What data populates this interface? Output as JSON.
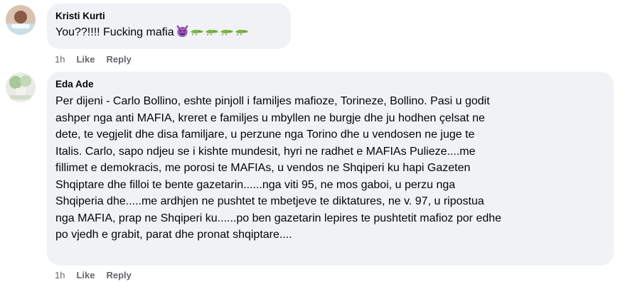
{
  "comments": [
    {
      "author": "Kristi Kurti",
      "text": "You??!!!! Fucking mafia",
      "emoji": [
        "smiling-imp-emoji",
        "crocodile-emoji",
        "crocodile-emoji",
        "crocodile-emoji",
        "crocodile-emoji"
      ],
      "time": "1h",
      "like_label": "Like",
      "reply_label": "Reply"
    },
    {
      "author": "Eda Ade",
      "lines": [
        "Per dijeni - Carlo Bollino, eshte pinjoll i familjes mafioze, Torineze, Bollino. Pasi u godit",
        "ashper nga anti MAFIA, kreret e familjes u mbyllen ne burgje dhe ju hodhen çelsat ne",
        "dete, te vegjelit dhe disa familjare, u perzune nga Torino dhe u vendosen ne juge te",
        "Italis. Carlo, sapo ndjeu se i kishte mundesit, hyri ne radhet e MAFIAs Pulieze....me",
        "fillimet e demokracis, me porosi te MAFIAs, u vendos ne Shqiperi ku hapi Gazeten",
        "Shqiptare dhe filloi te bente gazetarin......nga viti 95, ne mos gaboi, u perzu nga",
        "Shqiperia dhe.....me ardhjen ne pushtet te mbetjeve te diktatures, ne v. 97, u ripostua",
        "nga MAFIA, prap ne Shqiperi ku......po ben gazetarin lepires te pushtetit mafioz por edhe",
        "po vjedh e grabit, parat dhe pronat shqiptare...."
      ],
      "time": "1h",
      "like_label": "Like",
      "reply_label": "Reply"
    }
  ],
  "colors": {
    "bubble": "#f0f2f5",
    "text": "#050505",
    "meta": "#65676b"
  }
}
